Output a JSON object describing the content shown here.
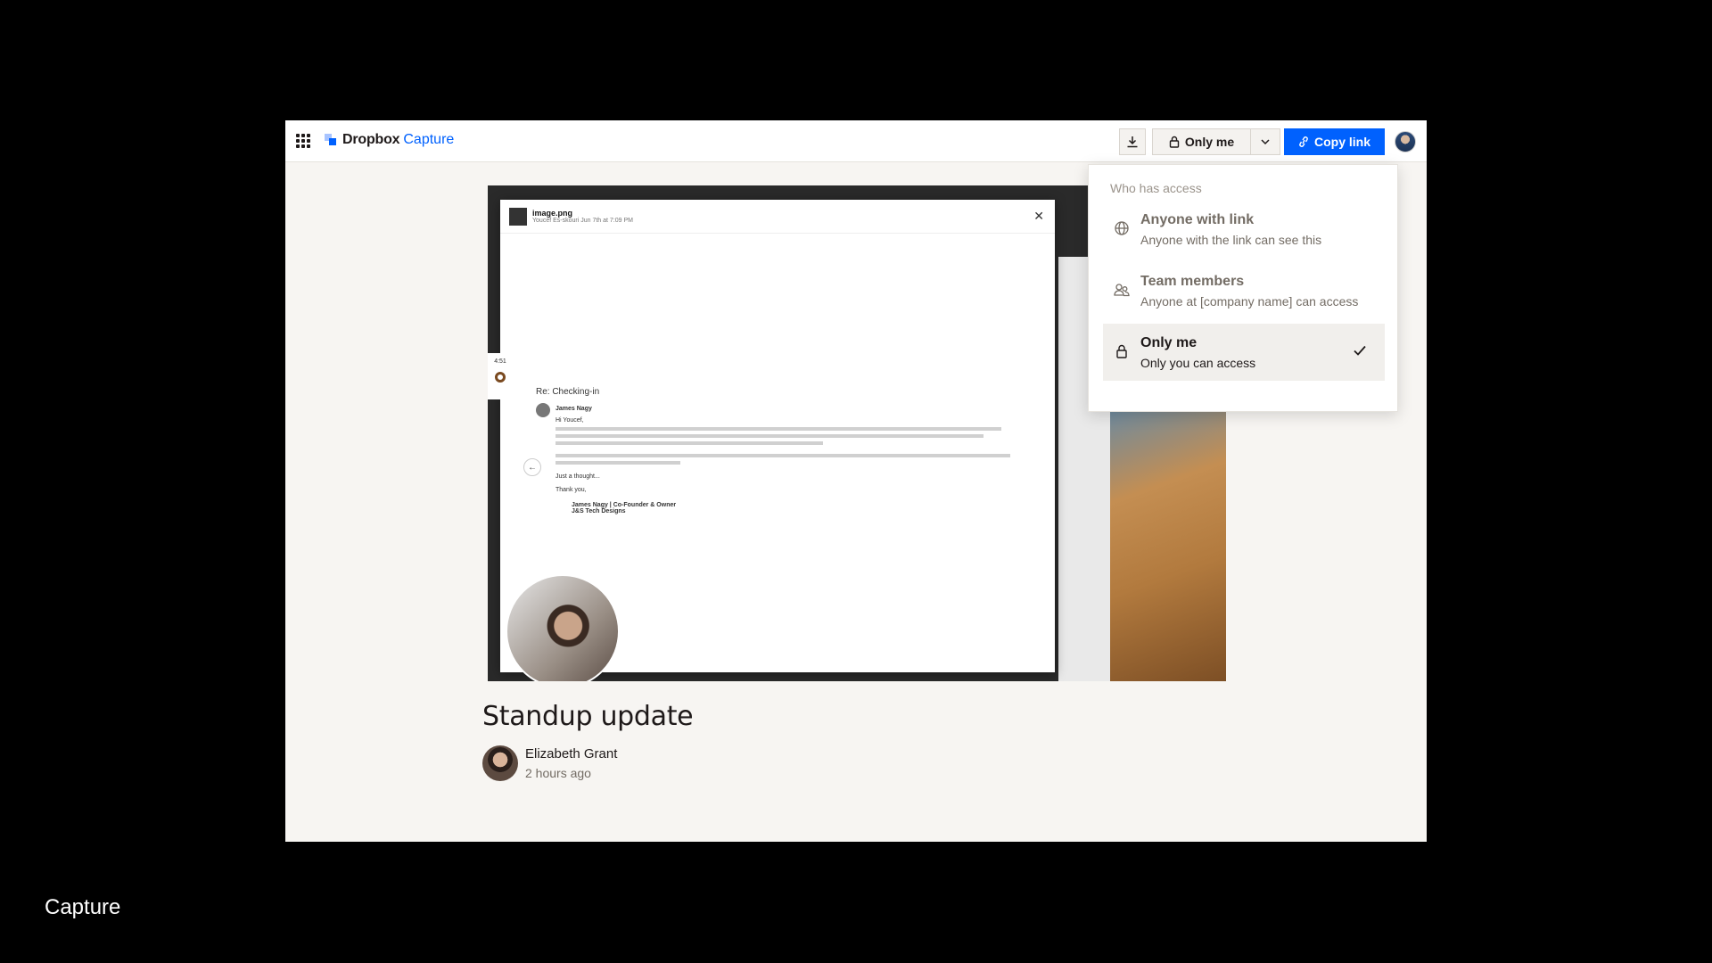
{
  "header": {
    "brand": "Dropbox",
    "product": "Capture",
    "privacy_label": "Only me",
    "copy_link_label": "Copy link"
  },
  "video": {
    "file_name": "image.png",
    "file_meta": "Youcef Es-skouri  Jun 7th at 7:09 PM",
    "email_subject": "Re: Checking-in",
    "email_sender": "James Nagy",
    "email_greeting": "Hi Youcef,",
    "email_closing": "Just a thought...",
    "email_thanks": "Thank you,",
    "email_signature": "James Nagy | Co-Founder & Owner",
    "email_company": "J&S Tech Designs",
    "timer": "4:51"
  },
  "post": {
    "title": "Standup update",
    "author": "Elizabeth Grant",
    "time": "2 hours ago"
  },
  "access_menu": {
    "heading": "Who has access",
    "options": [
      {
        "icon": "globe-icon",
        "title": "Anyone with link",
        "desc": "Anyone with the link can see this",
        "selected": false
      },
      {
        "icon": "team-icon",
        "title": "Team members",
        "desc": "Anyone at [company name] can access",
        "selected": false
      },
      {
        "icon": "lock-icon",
        "title": "Only me",
        "desc": "Only you can access",
        "selected": true
      }
    ]
  },
  "caption": "Capture"
}
